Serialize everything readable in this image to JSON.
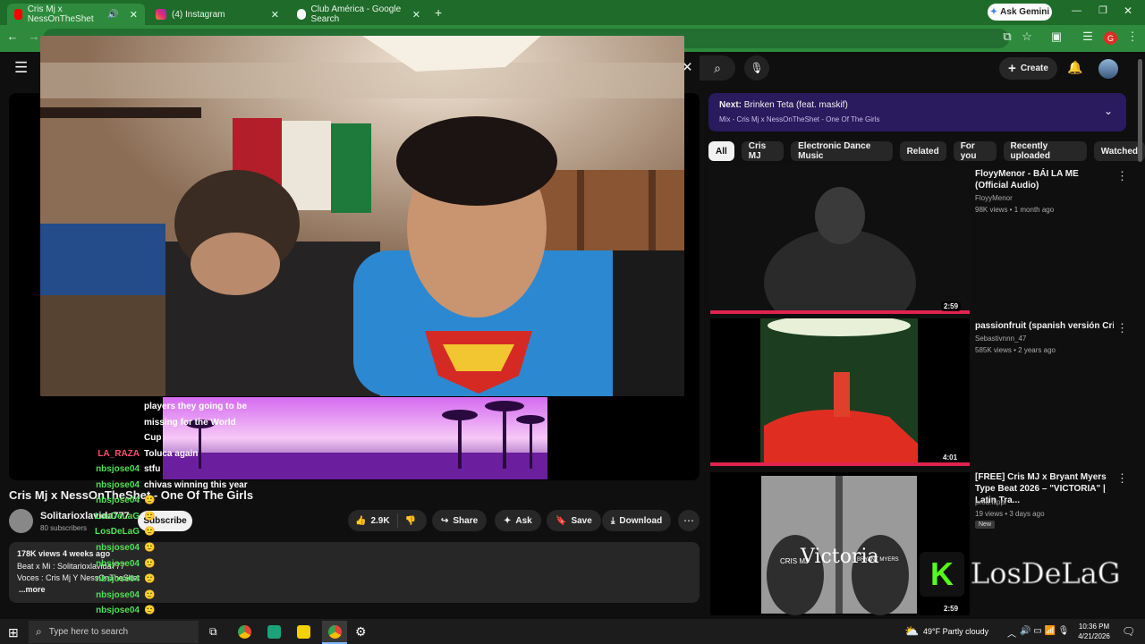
{
  "browser": {
    "tabs": [
      {
        "label": "Cris Mj x NessOnTheShet"
      },
      {
        "label": "(4) Instagram"
      },
      {
        "label": "Club América - Google Search"
      }
    ],
    "ask_gemini": "Ask Gemini",
    "profile_initial": "G"
  },
  "youtube": {
    "create_label": "Create",
    "next_bar": {
      "prefix": "Next:",
      "title": "Brinken Teta (feat. maskif)",
      "mix": "Mix - Cris Mj x NessOnTheShet - One Of The Girls"
    },
    "chips": [
      "All",
      "Cris MJ",
      "Electronic Dance Music",
      "Related",
      "For you",
      "Recently uploaded",
      "Watched"
    ],
    "video": {
      "title": "Cris Mj x NessOnTheShet - One Of The Girls",
      "channel": "Solitarioxlavida777",
      "subscribers": "80 subscribers",
      "subscribe": "Subscribe",
      "likes": "2.9K",
      "share": "Share",
      "ask": "Ask",
      "save": "Save",
      "download": "Download",
      "views_date": "178K views  4 weeks ago",
      "desc1": "Beat x Mi : Solitarioxlavida777",
      "desc2": "Voces : Cris Mj Y NessOnTheShet",
      "more": "...more"
    },
    "recommendations": [
      {
        "title": "FloyyMenor - BÁI LA ME (Official Audio)",
        "channel": "FloyyMenor",
        "meta": "98K views • 1 month ago",
        "duration": "2:59",
        "badge": ""
      },
      {
        "title": "passionfruit (spanish versión Cris Mj",
        "channel": "Sebastivnnn_47",
        "meta": "585K views • 2 years ago",
        "duration": "4:01",
        "badge": ""
      },
      {
        "title": "[FREE] Cris MJ x Bryant Myers Type Beat 2026 – \"VICTORIA\" | Latin Tra...",
        "channel": "prod.flippr",
        "meta": "19 views • 3 days ago",
        "duration": "2:59",
        "badge": "New"
      }
    ],
    "thumb3_text": "Victoria",
    "thumb3_left": "CRIS MJ",
    "thumb3_right": "BRYANT MYERS"
  },
  "overlay": {
    "chat": [
      {
        "name": "",
        "msg": "players they going to be"
      },
      {
        "name": "",
        "msg": "missing for the World"
      },
      {
        "name": "",
        "msg": "Cup"
      },
      {
        "name": "LA_RAZA",
        "msg": "Toluca again"
      },
      {
        "name": "nbsjose04",
        "msg": "stfu"
      },
      {
        "name": "nbsjose04",
        "msg": "chivas winning this year"
      },
      {
        "name": "nbsjose04",
        "msg": "🙂"
      },
      {
        "name": "LosDeLaG",
        "msg": "🙂"
      },
      {
        "name": "LosDeLaG",
        "msg": "🙂"
      },
      {
        "name": "nbsjose04",
        "msg": "🙂"
      },
      {
        "name": "nbsjose04",
        "msg": "🙂"
      },
      {
        "name": "nbsjose04",
        "msg": "🙂"
      },
      {
        "name": "nbsjose04",
        "msg": "🙂"
      },
      {
        "name": "nbsjose04",
        "msg": "🙂"
      }
    ],
    "brand_letter": "K",
    "brand_name": "LosDeLaG"
  },
  "taskbar": {
    "search_placeholder": "Type here to search",
    "weather": "49°F  Partly cloudy",
    "time": "10:36 PM",
    "date": "4/21/2026"
  },
  "colors": {
    "tab_bar": "#1f6b2a",
    "toolbar": "#2e8b3d",
    "yt_bg": "#0f0f0f",
    "next_bar": "#2a1a5e",
    "chat_name": "#4fe05a"
  }
}
